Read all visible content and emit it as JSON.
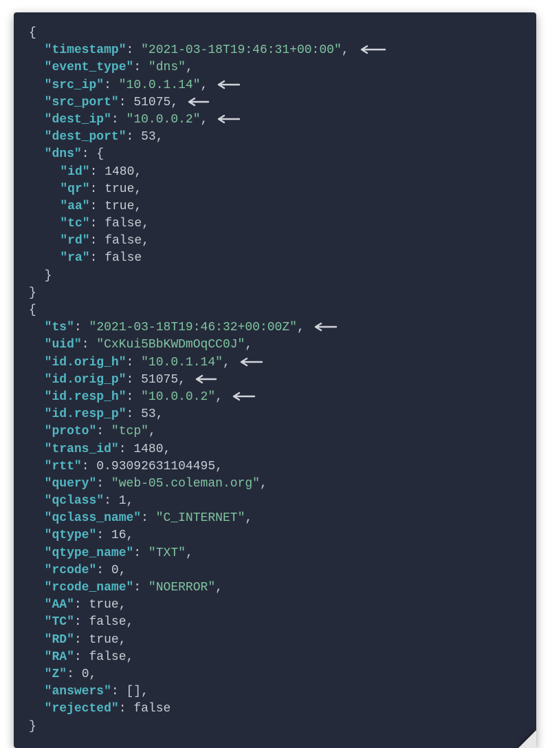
{
  "block1": {
    "timestamp": "2021-03-18T19:46:31+00:00",
    "event_type": "dns",
    "src_ip": "10.0.1.14",
    "src_port": 51075,
    "dest_ip": "10.0.0.2",
    "dest_port": 53,
    "dns": {
      "id": 1480,
      "qr": "true",
      "aa": "true",
      "tc": "false",
      "rd": "false",
      "ra": "false"
    }
  },
  "block2": {
    "ts": "2021-03-18T19:46:32+00:00Z",
    "uid": "CxKui5BbKWDmOqCC0J",
    "id_orig_h": "10.0.1.14",
    "id_orig_p": 51075,
    "id_resp_h": "10.0.0.2",
    "id_resp_p": 53,
    "proto": "tcp",
    "trans_id": 1480,
    "rtt": 0.93092631104495,
    "query": "web-05.coleman.org",
    "qclass": 1,
    "qclass_name": "C_INTERNET",
    "qtype": 16,
    "qtype_name": "TXT",
    "rcode": 0,
    "rcode_name": "NOERROR",
    "AA": "true",
    "TC": "false",
    "RD": "true",
    "RA": "false",
    "Z": 0,
    "answers": "[]",
    "rejected": "false"
  },
  "labels": {
    "b1": {
      "timestamp": "\"timestamp\"",
      "event_type": "\"event_type\"",
      "src_ip": "\"src_ip\"",
      "src_port": "\"src_port\"",
      "dest_ip": "\"dest_ip\"",
      "dest_port": "\"dest_port\"",
      "dns": "\"dns\"",
      "id": "\"id\"",
      "qr": "\"qr\"",
      "aa": "\"aa\"",
      "tc": "\"tc\"",
      "rd": "\"rd\"",
      "ra": "\"ra\""
    },
    "b2": {
      "ts": "\"ts\"",
      "uid": "\"uid\"",
      "id_orig_h": "\"id.orig_h\"",
      "id_orig_p": "\"id.orig_p\"",
      "id_resp_h": "\"id.resp_h\"",
      "id_resp_p": "\"id.resp_p\"",
      "proto": "\"proto\"",
      "trans_id": "\"trans_id\"",
      "rtt": "\"rtt\"",
      "query": "\"query\"",
      "qclass": "\"qclass\"",
      "qclass_name": "\"qclass_name\"",
      "qtype": "\"qtype\"",
      "qtype_name": "\"qtype_name\"",
      "rcode": "\"rcode\"",
      "rcode_name": "\"rcode_name\"",
      "AA": "\"AA\"",
      "TC": "\"TC\"",
      "RD": "\"RD\"",
      "RA": "\"RA\"",
      "Z": "\"Z\"",
      "answers": "\"answers\"",
      "rejected": "\"rejected\""
    }
  }
}
